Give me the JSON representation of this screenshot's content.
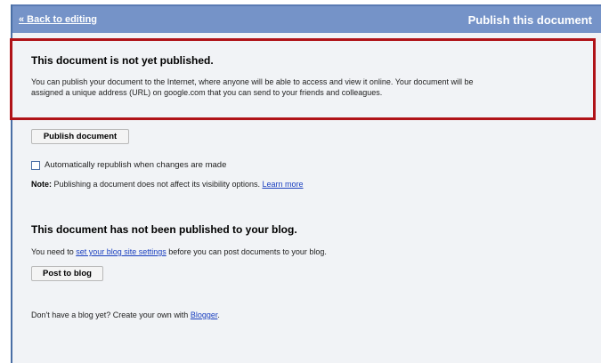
{
  "header": {
    "back_link": "« Back to editing",
    "title": "Publish this document"
  },
  "publish_section": {
    "heading": "This document is not yet published.",
    "description": "You can publish your document to the Internet, where anyone will be able to access and view it online. Your document will be assigned a unique address (URL) on google.com that you can send to your friends and colleagues.",
    "publish_button": "Publish document",
    "auto_republish_label": "Automatically republish when changes are made",
    "auto_republish_checked": false,
    "note_label": "Note:",
    "note_text": " Publishing a document does not affect its visibility options. ",
    "learn_more": "Learn more"
  },
  "blog_section": {
    "heading": "This document has not been published to your blog.",
    "need_prefix": "You need to ",
    "settings_link": "set your blog site settings",
    "need_suffix": " before you can post documents to your blog.",
    "post_button": "Post to blog",
    "no_blog_prefix": "Don't have a blog yet? Create your own with ",
    "blogger_link": "Blogger",
    "no_blog_suffix": "."
  },
  "colors": {
    "header_bg": "#7593c8",
    "page_bg": "#f1f3f6",
    "highlight_border": "#b01318",
    "link": "#1a3fbf"
  }
}
